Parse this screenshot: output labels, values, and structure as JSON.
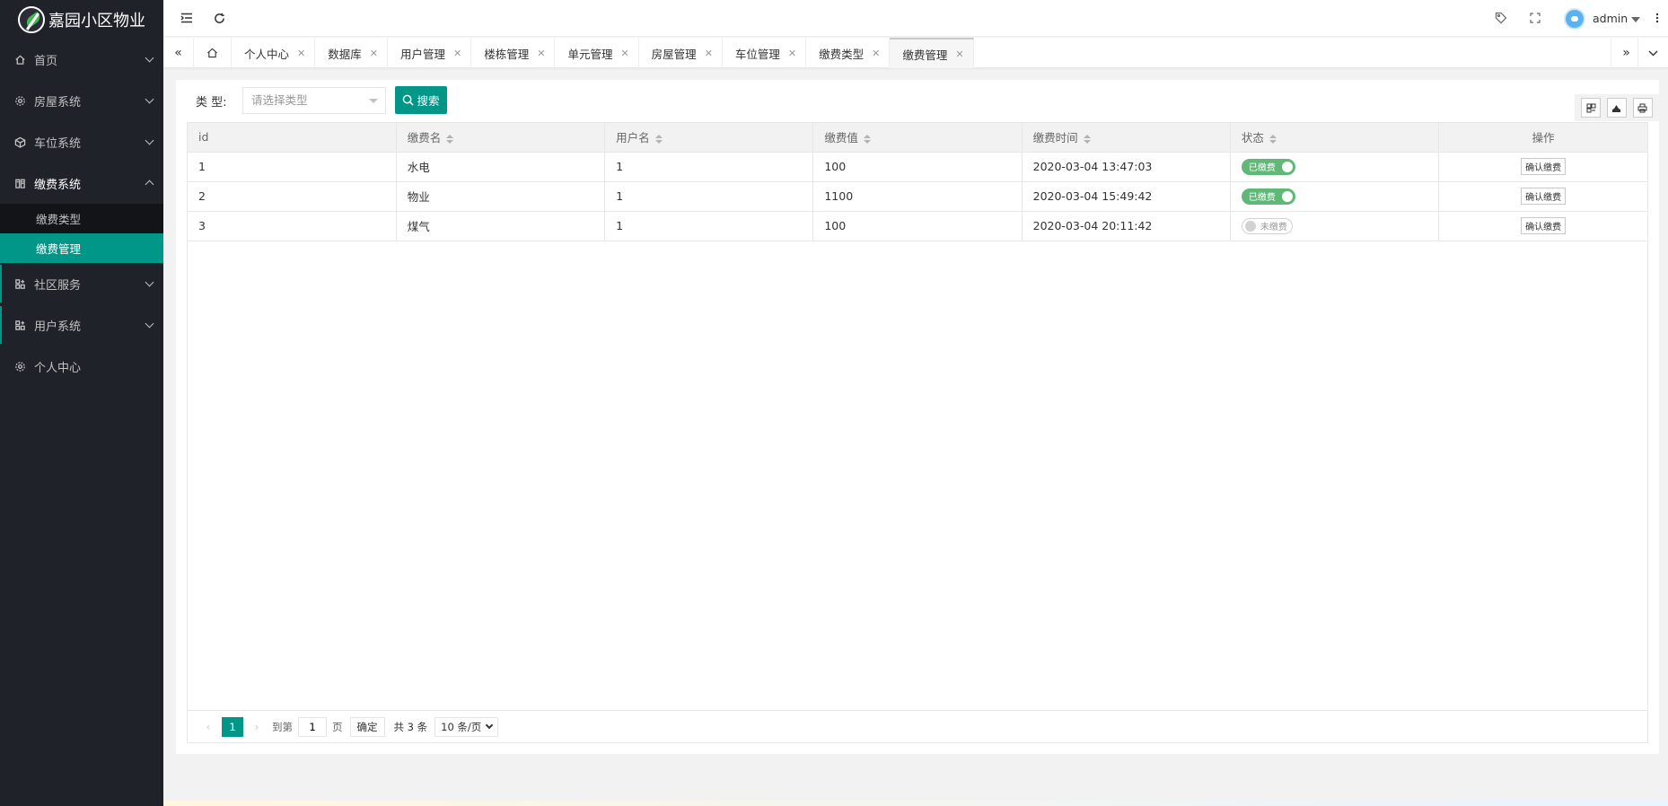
{
  "app": {
    "title": "嘉园小区物业"
  },
  "sidebar": {
    "items": [
      {
        "label": "首页",
        "icon": "home-icon"
      },
      {
        "label": "房屋系统",
        "icon": "gear-icon"
      },
      {
        "label": "车位系统",
        "icon": "cube-icon"
      },
      {
        "label": "缴费系统",
        "icon": "book-icon",
        "children": [
          {
            "label": "缴费类型"
          },
          {
            "label": "缴费管理"
          }
        ]
      },
      {
        "label": "社区服务",
        "icon": "grid-icon"
      },
      {
        "label": "用户系统",
        "icon": "grid-icon"
      },
      {
        "label": "个人中心",
        "icon": "gear-icon"
      }
    ]
  },
  "header": {
    "user": "admin"
  },
  "tabs": [
    {
      "label": "个人中心"
    },
    {
      "label": "数据库"
    },
    {
      "label": "用户管理"
    },
    {
      "label": "楼栋管理"
    },
    {
      "label": "单元管理"
    },
    {
      "label": "房屋管理"
    },
    {
      "label": "车位管理"
    },
    {
      "label": "缴费类型"
    },
    {
      "label": "缴费管理"
    }
  ],
  "filter": {
    "label": "类 型:",
    "placeholder": "请选择类型",
    "search_label": "搜索"
  },
  "table": {
    "columns": [
      "id",
      "缴费名",
      "用户名",
      "缴费值",
      "缴费时间",
      "状态",
      "操作"
    ],
    "rows": [
      {
        "id": "1",
        "name": "水电",
        "user": "1",
        "value": "100",
        "time": "2020-03-04 13:47:03",
        "status": "已缴费",
        "paid": true,
        "action": "确认缴费"
      },
      {
        "id": "2",
        "name": "物业",
        "user": "1",
        "value": "1100",
        "time": "2020-03-04 15:49:42",
        "status": "已缴费",
        "paid": true,
        "action": "确认缴费"
      },
      {
        "id": "3",
        "name": "煤气",
        "user": "1",
        "value": "100",
        "time": "2020-03-04 20:11:42",
        "status": "未缴费",
        "paid": false,
        "action": "确认缴费"
      }
    ]
  },
  "pager": {
    "current": "1",
    "goto_label": "到第",
    "goto_value": "1",
    "page_unit": "页",
    "confirm": "确定",
    "total": "共 3 条",
    "per_page": "10 条/页"
  },
  "colors": {
    "primary": "#009688",
    "sidebar": "#20222a",
    "switch_on": "#5fb878"
  }
}
